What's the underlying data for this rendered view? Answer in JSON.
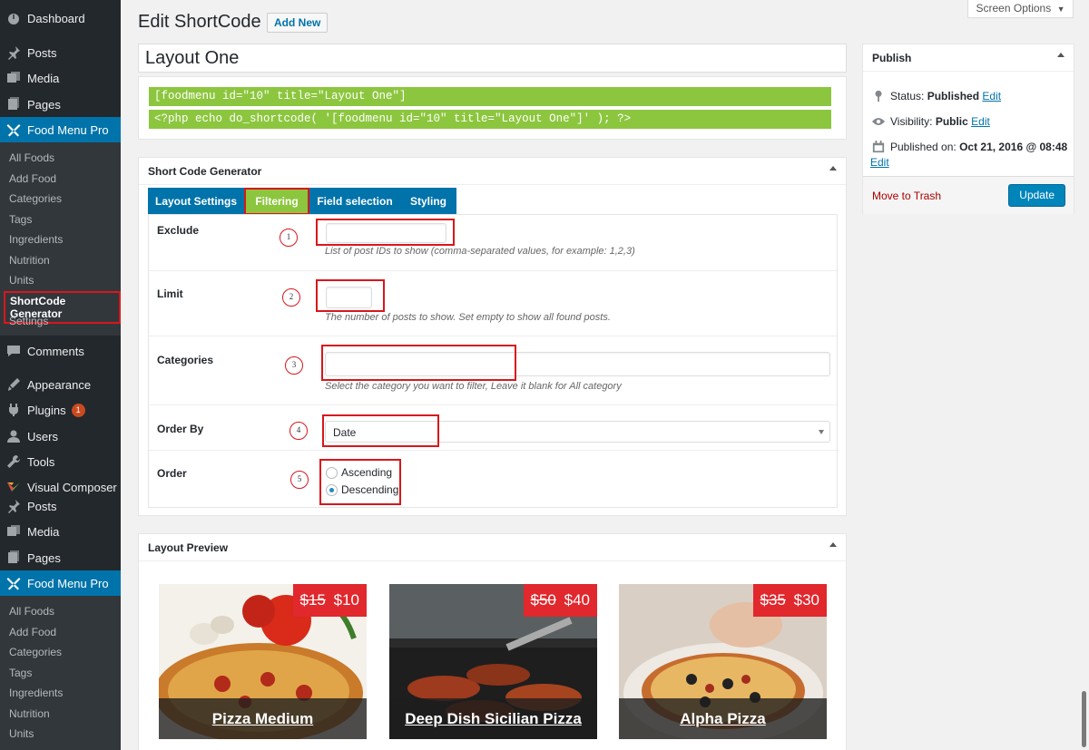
{
  "sidebar": {
    "top_items": [
      {
        "label": "Dashboard",
        "icon": "dashboard-icon"
      },
      {
        "label": "Posts",
        "icon": "pin-icon"
      },
      {
        "label": "Media",
        "icon": "media-icon"
      },
      {
        "label": "Pages",
        "icon": "pages-icon"
      },
      {
        "label": "Food Menu Pro",
        "icon": "food-menu-icon"
      }
    ],
    "submenu_1": [
      "All Foods",
      "Add Food",
      "Categories",
      "Tags",
      "Ingredients",
      "Nutrition",
      "Units",
      "ShortCode Generator",
      "Settings"
    ],
    "mid_items": [
      {
        "label": "Comments",
        "icon": "comments-icon"
      },
      {
        "label": "Appearance",
        "icon": "appearance-icon"
      },
      {
        "label": "Plugins",
        "icon": "plugins-icon",
        "badge": "1"
      },
      {
        "label": "Users",
        "icon": "users-icon"
      },
      {
        "label": "Tools",
        "icon": "tools-icon"
      },
      {
        "label": "Visual Composer",
        "icon": "visual-composer-icon"
      },
      {
        "label": "Posts",
        "icon": "pin-icon"
      },
      {
        "label": "Media",
        "icon": "media-icon"
      },
      {
        "label": "Pages",
        "icon": "pages-icon"
      },
      {
        "label": "Food Menu Pro",
        "icon": "food-menu-icon"
      }
    ],
    "submenu_2": [
      "All Foods",
      "Add Food",
      "Categories",
      "Tags",
      "Ingredients",
      "Nutrition",
      "Units"
    ]
  },
  "header": {
    "title": "Edit ShortCode",
    "add_new": "Add New",
    "screen_options": "Screen Options"
  },
  "post": {
    "title_value": "Layout One",
    "shortcode": "[foodmenu id=\"10\" title=\"Layout One\"]",
    "php_code": "<?php echo do_shortcode( '[foodmenu id=\"10\" title=\"Layout One\"]' ); ?>"
  },
  "generator": {
    "title": "Short Code Generator",
    "tabs": [
      "Layout Settings",
      "Filtering",
      "Field selection",
      "Styling"
    ],
    "active_tab": "Filtering",
    "fields": {
      "exclude": {
        "label": "Exclude",
        "value": "",
        "desc": "List of post IDs to show (comma-separated values, for example: 1,2,3)",
        "num": "1"
      },
      "limit": {
        "label": "Limit",
        "value": "",
        "desc": "The number of posts to show. Set empty to show all found posts.",
        "num": "2"
      },
      "categories": {
        "label": "Categories",
        "value": "",
        "desc": "Select the category you want to filter, Leave it blank for All category",
        "num": "3"
      },
      "order_by": {
        "label": "Order By",
        "selected": "Date",
        "num": "4"
      },
      "order": {
        "label": "Order",
        "options": [
          "Ascending",
          "Descending"
        ],
        "selected": "Descending",
        "num": "5"
      }
    }
  },
  "preview": {
    "title": "Layout Preview",
    "cards": [
      {
        "title": "Pizza Medium",
        "old_price": "$15",
        "price": "$10"
      },
      {
        "title": "Deep Dish Sicilian Pizza",
        "old_price": "$50",
        "price": "$40"
      },
      {
        "title": "Alpha Pizza",
        "old_price": "$35",
        "price": "$30"
      }
    ]
  },
  "publish": {
    "title": "Publish",
    "status_label": "Status:",
    "status_value": "Published",
    "visibility_label": "Visibility:",
    "visibility_value": "Public",
    "published_label": "Published on:",
    "published_value": "Oct 21, 2016 @ 08:48",
    "edit": "Edit",
    "trash": "Move to Trash",
    "update": "Update"
  },
  "colors": {
    "accent": "#0073aa",
    "code_bg": "#8cc63e",
    "annotation": "#d8171c",
    "price_bg": "#e0282d"
  }
}
